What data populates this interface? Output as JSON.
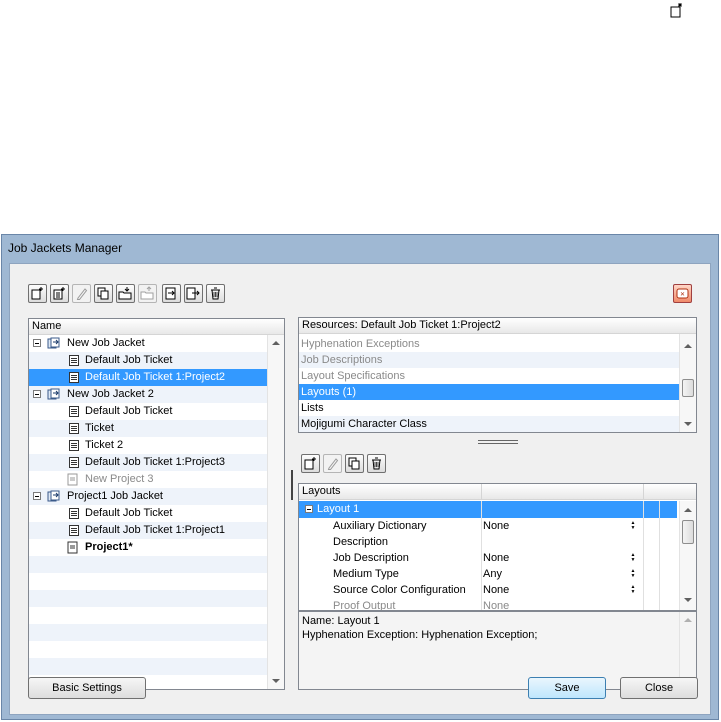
{
  "window": {
    "title": "Job Jackets Manager"
  },
  "toolbar_icons": [
    "new-jacket-icon",
    "new-ticket-icon",
    "edit-icon",
    "duplicate-icon",
    "import-icon",
    "export-icon",
    "link-icon",
    "save-as-icon",
    "delete-icon"
  ],
  "tree": {
    "header": "Name",
    "items": [
      {
        "label": "New Job Jacket",
        "level": 0,
        "type": "jacket",
        "state": "normal"
      },
      {
        "label": "Default Job Ticket",
        "level": 1,
        "type": "ticket",
        "state": "normal"
      },
      {
        "label": "Default Job Ticket 1:Project2",
        "level": 1,
        "type": "ticket",
        "state": "selected"
      },
      {
        "label": "New Job Jacket 2",
        "level": 0,
        "type": "jacket",
        "state": "normal"
      },
      {
        "label": "Default Job Ticket",
        "level": 1,
        "type": "ticket",
        "state": "normal"
      },
      {
        "label": "Ticket",
        "level": 1,
        "type": "ticket",
        "state": "normal"
      },
      {
        "label": "Ticket 2",
        "level": 1,
        "type": "ticket",
        "state": "normal"
      },
      {
        "label": "Default Job Ticket 1:Project3",
        "level": 1,
        "type": "ticket",
        "state": "normal"
      },
      {
        "label": "New Project 3",
        "level": 1,
        "type": "project",
        "state": "gray"
      },
      {
        "label": "Project1 Job Jacket",
        "level": 0,
        "type": "jacket",
        "state": "normal"
      },
      {
        "label": "Default Job Ticket",
        "level": 1,
        "type": "ticket",
        "state": "normal"
      },
      {
        "label": "Default Job Ticket 1:Project1",
        "level": 1,
        "type": "ticket",
        "state": "normal"
      },
      {
        "label": "Project1*",
        "level": 1,
        "type": "project",
        "state": "bold"
      }
    ]
  },
  "resources": {
    "header": "Resources: Default Job Ticket 1:Project2",
    "items": [
      {
        "label": "Hyphenation Exceptions",
        "state": "gray"
      },
      {
        "label": "Job Descriptions",
        "state": "gray"
      },
      {
        "label": "Layout Specifications",
        "state": "gray"
      },
      {
        "label": "Layouts (1)",
        "state": "selected"
      },
      {
        "label": "Lists",
        "state": "normal"
      },
      {
        "label": "Mojigumi Character Class",
        "state": "normal"
      }
    ]
  },
  "layouts": {
    "header": "Layouts",
    "group": "Layout 1",
    "rows": [
      {
        "name": "Auxiliary Dictionary",
        "value": "None",
        "spinner": true,
        "state": "normal"
      },
      {
        "name": "Description",
        "value": "",
        "spinner": false,
        "state": "normal"
      },
      {
        "name": "Job Description",
        "value": "None",
        "spinner": true,
        "state": "normal"
      },
      {
        "name": "Medium Type",
        "value": "Any",
        "spinner": true,
        "state": "normal"
      },
      {
        "name": "Source Color Configuration",
        "value": "None",
        "spinner": true,
        "state": "normal"
      },
      {
        "name": "Proof Output",
        "value": "None",
        "spinner": false,
        "state": "gray"
      }
    ]
  },
  "description": {
    "line1": "Name: Layout 1",
    "line2": "Hyphenation Exception: Hyphenation Exception;"
  },
  "buttons": {
    "basic_settings": "Basic Settings",
    "save": "Save",
    "close": "Close"
  }
}
